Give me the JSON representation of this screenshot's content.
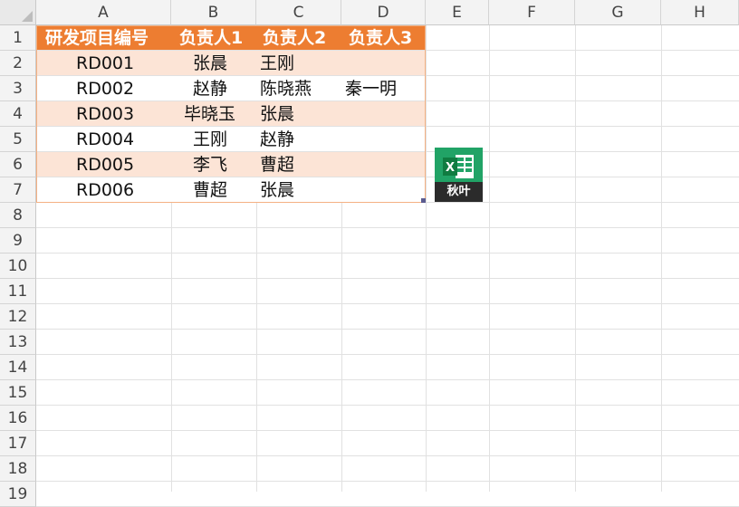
{
  "columns": [
    "A",
    "B",
    "C",
    "D",
    "E",
    "F",
    "G",
    "H"
  ],
  "rows": [
    "1",
    "2",
    "3",
    "4",
    "5",
    "6",
    "7",
    "8",
    "9",
    "10",
    "11",
    "12",
    "13",
    "14",
    "15",
    "16",
    "17",
    "18",
    "19"
  ],
  "table": {
    "headers": [
      "研发项目编号",
      "负责人1",
      "负责人2",
      "负责人3"
    ],
    "rows": [
      [
        "RD001",
        "张晨",
        "王刚",
        ""
      ],
      [
        "RD002",
        "赵静",
        "陈晓燕",
        "秦一明"
      ],
      [
        "RD003",
        "毕晓玉",
        "张晨",
        ""
      ],
      [
        "RD004",
        "王刚",
        "赵静",
        ""
      ],
      [
        "RD005",
        "李飞",
        "曹超",
        ""
      ],
      [
        "RD006",
        "曹超",
        "张晨",
        ""
      ]
    ]
  },
  "colors": {
    "header_fill": "#ed7d31",
    "band_fill": "#fce4d6",
    "logo_green": "#21a366"
  },
  "logo": {
    "letter": "X",
    "label": "秋叶",
    "icon": "excel-logo-icon"
  }
}
